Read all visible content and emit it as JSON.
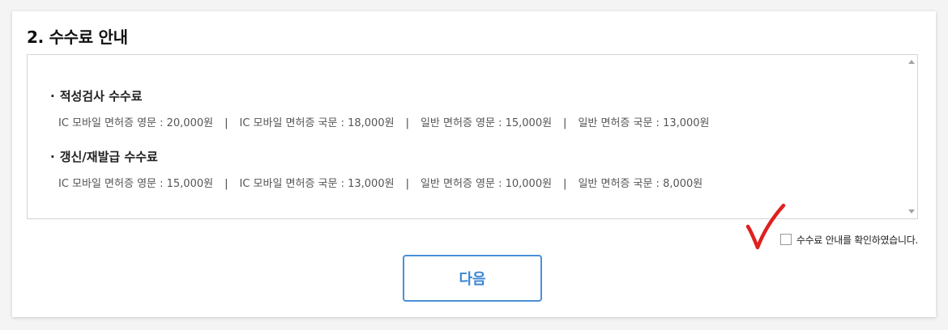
{
  "section": {
    "title": "2. 수수료 안내"
  },
  "fees": {
    "groups": [
      {
        "heading": "적성검사 수수료",
        "items": [
          "IC 모바일 면허증 영문 : 20,000원",
          "IC 모바일 면허증 국문 : 18,000원",
          "일반 면허증 영문 : 15,000원",
          "일반 면허증 국문 : 13,000원"
        ]
      },
      {
        "heading": "갱신/재발급 수수료",
        "items": [
          "IC 모바일 면허증 영문 : 15,000원",
          "IC 모바일 면허증 국문 : 13,000원",
          "일반 면허증 영문 : 10,000원",
          "일반 면허증 국문 : 8,000원"
        ]
      }
    ],
    "separator": "|",
    "bullet": "·"
  },
  "confirm": {
    "label": "수수료 안내를 확인하였습니다.",
    "checked": false
  },
  "actions": {
    "next_label": "다음"
  },
  "colors": {
    "accent": "#3d86d4",
    "check_mark": "#e0201e"
  },
  "icons": {
    "scroll_up": "triangle-up",
    "scroll_down": "triangle-down",
    "annotation": "red-checkmark"
  }
}
